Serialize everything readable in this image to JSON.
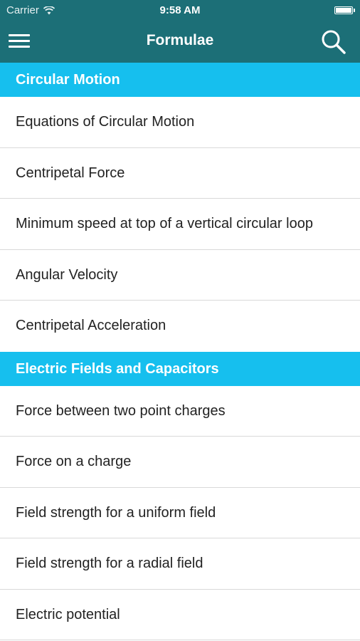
{
  "status_bar": {
    "carrier": "Carrier",
    "time": "9:58 AM"
  },
  "header": {
    "title": "Formulae"
  },
  "colors": {
    "nav_background": "#1c6f77",
    "section_header_background": "#16bfee",
    "text": "#222222",
    "separator": "#d9d9d9"
  },
  "icons": {
    "menu": "hamburger-menu-icon",
    "search": "magnifying-glass-icon",
    "wifi": "wifi-icon",
    "battery": "battery-icon"
  },
  "sections": [
    {
      "title": "Circular Motion",
      "items": [
        "Equations of Circular Motion",
        "Centripetal Force",
        "Minimum speed at top of a vertical circular loop",
        "Angular Velocity",
        "Centripetal Acceleration"
      ]
    },
    {
      "title": "Electric Fields and Capacitors",
      "items": [
        "Force between two point charges",
        "Force on a charge",
        "Field strength for a uniform field",
        "Field strength for a radial field",
        "Electric potential"
      ]
    }
  ]
}
